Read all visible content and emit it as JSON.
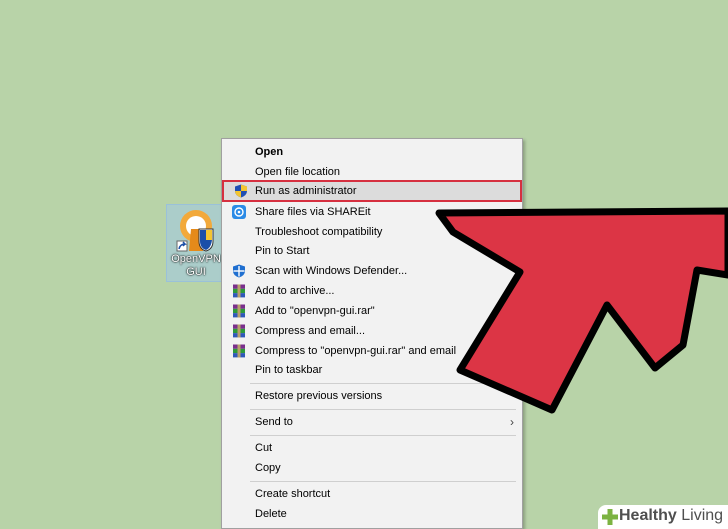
{
  "desktop_icon": {
    "label_line1": "OpenVPN",
    "label_line2": "GUI"
  },
  "context_menu": {
    "items": [
      {
        "label": "Open",
        "icon": "",
        "bold": true
      },
      {
        "label": "Open file location",
        "icon": ""
      },
      {
        "label": "Run as administrator",
        "icon": "uac-shield-icon",
        "highlighted": true
      },
      {
        "label": "Share files via SHAREit",
        "icon": "shareit-icon"
      },
      {
        "label": "Troubleshoot compatibility",
        "icon": ""
      },
      {
        "label": "Pin to Start",
        "icon": ""
      },
      {
        "label": "Scan with Windows Defender...",
        "icon": "windows-defender-icon"
      },
      {
        "label": "Add to archive...",
        "icon": "winrar-icon"
      },
      {
        "label": "Add to \"openvpn-gui.rar\"",
        "icon": "winrar-icon"
      },
      {
        "label": "Compress and email...",
        "icon": "winrar-icon"
      },
      {
        "label": "Compress to \"openvpn-gui.rar\" and email",
        "icon": "winrar-icon"
      },
      {
        "label": "Pin to taskbar",
        "icon": ""
      },
      {
        "label": "Restore previous versions",
        "icon": ""
      },
      {
        "label": "Send to",
        "icon": "",
        "submenu": true
      },
      {
        "label": "Cut",
        "icon": ""
      },
      {
        "label": "Copy",
        "icon": ""
      },
      {
        "label": "Create shortcut",
        "icon": ""
      },
      {
        "label": "Delete",
        "icon": ""
      }
    ],
    "submenu_glyph": "›"
  },
  "colors": {
    "background": "#b8d3a8",
    "highlight_border": "#d63040",
    "arrow_fill": "#dc3545",
    "arrow_stroke": "#000000"
  },
  "watermark": {
    "brand_bold": "Healthy",
    "brand_light": " Living"
  }
}
